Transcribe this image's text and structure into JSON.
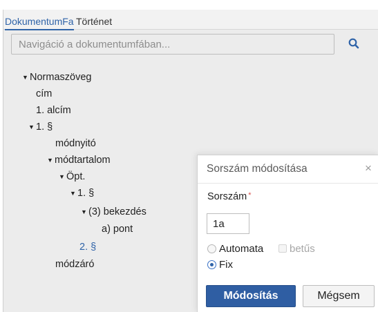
{
  "tabs": [
    {
      "label": "DokumentumFa",
      "active": true
    },
    {
      "label": "Történet",
      "active": false
    }
  ],
  "search": {
    "placeholder": "Navigáció a dokumentumfában...",
    "value": "",
    "icon": "search-icon"
  },
  "tree": [
    {
      "label": "Normaszöveg",
      "expanded": true,
      "level": 0
    },
    {
      "label": "cím",
      "level": 1
    },
    {
      "label": "1. alcím",
      "level": 1
    },
    {
      "label": "1. §",
      "expanded": true,
      "level": 1
    },
    {
      "label": "módnyitó",
      "level": 2
    },
    {
      "label": "módtartalom",
      "expanded": true,
      "level": 2
    },
    {
      "label": "Öpt.",
      "expanded": true,
      "level": 3
    },
    {
      "label": "1. §",
      "expanded": true,
      "level": 4
    },
    {
      "label": "(3) bekezdés",
      "expanded": true,
      "level": 5
    },
    {
      "label": "a) pont",
      "level": 6
    },
    {
      "label": "2. §",
      "level": 4,
      "selected": true
    },
    {
      "label": "módzáró",
      "level": 2
    }
  ],
  "modal": {
    "title": "Sorszám módosítása",
    "close_symbol": "×",
    "field_label": "Sorszám",
    "required_mark": "*",
    "number_value": "1a",
    "option_automata": "Automata",
    "option_betus": "betűs",
    "option_fix": "Fix",
    "selected_option": "Fix",
    "submit_label": "Módosítás",
    "cancel_label": "Mégsem"
  },
  "colors": {
    "accent": "#2f63a8",
    "primary_button": "#2f5ea3",
    "panel_background": "#ececec",
    "required": "#d9534f"
  }
}
